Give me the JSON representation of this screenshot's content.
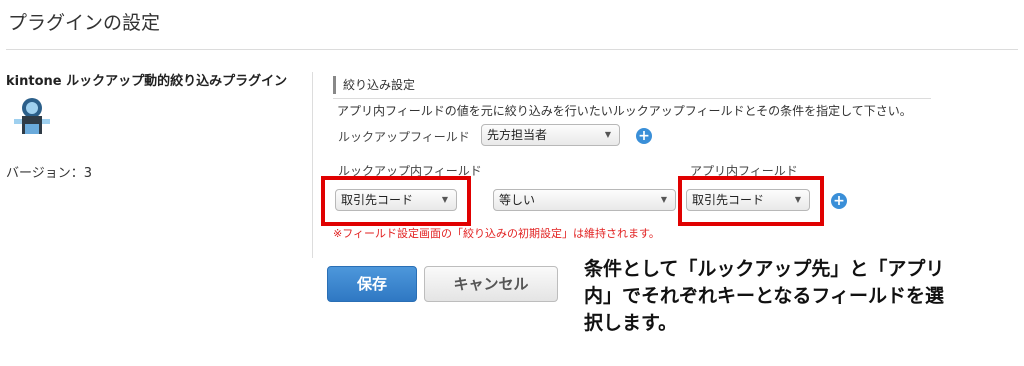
{
  "page": {
    "title": "プラグインの設定"
  },
  "plugin": {
    "name": "kintone ルックアップ動的絞り込みプラグイン",
    "version_label": "バージョン：3"
  },
  "section": {
    "title": "絞り込み設定",
    "description": "アプリ内フィールドの値を元に絞り込みを行いたいルックアップフィールドとその条件を指定して下さい。"
  },
  "lookup_field": {
    "label": "ルックアップフィールド",
    "value": "先方担当者"
  },
  "columns": {
    "lookup_inner_label": "ルックアップ内フィールド",
    "app_inner_label": "アプリ内フィールド"
  },
  "condition": {
    "lookup_inner_value": "取引先コード",
    "operator_value": "等しい",
    "app_inner_value": "取引先コード"
  },
  "note": "※フィールド設定画面の「絞り込みの初期設定」は維持されます。",
  "buttons": {
    "save": "保存",
    "cancel": "キャンセル"
  },
  "annotation": "条件として「ルックアップ先」と「アプリ内」でそれぞれキーとなるフィールドを選択します。",
  "icons": {
    "dropdown": "triangle-down",
    "add": "plus-circle",
    "plugin": "plugin-logo"
  },
  "colors": {
    "accent": "#3a8fd8",
    "highlight": "#e00000",
    "note": "#e22222",
    "save_button": "#2f78c3"
  }
}
